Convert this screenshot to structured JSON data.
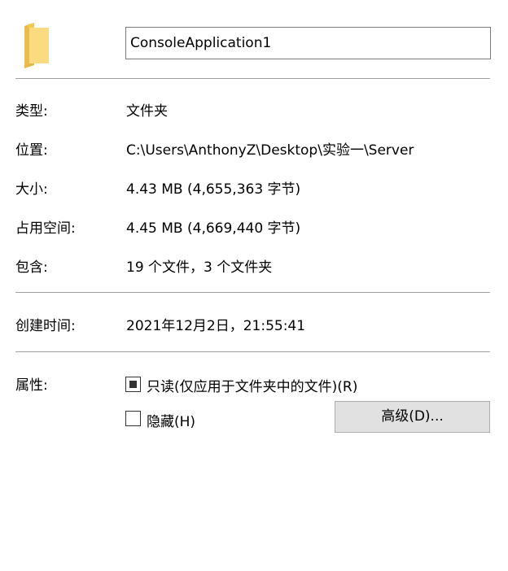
{
  "header": {
    "icon": "folder-icon",
    "name_value": "ConsoleApplication1"
  },
  "general": {
    "type_label": "类型:",
    "type_value": "文件夹",
    "location_label": "位置:",
    "location_value": "C:\\Users\\AnthonyZ\\Desktop\\实验一\\Server",
    "size_label": "大小:",
    "size_value": "4.43 MB (4,655,363 字节)",
    "size_on_disk_label": "占用空间:",
    "size_on_disk_value": "4.45 MB (4,669,440 字节)",
    "contains_label": "包含:",
    "contains_value": "19 个文件，3 个文件夹"
  },
  "dates": {
    "created_label": "创建时间:",
    "created_value": "2021年12月2日，21:55:41"
  },
  "attributes": {
    "label": "属性:",
    "readonly_label": "只读(仅应用于文件夹中的文件)(R)",
    "readonly_state": "indeterminate",
    "hidden_label": "隐藏(H)",
    "hidden_state": "unchecked",
    "advanced_button_label": "高级(D)..."
  },
  "colors": {
    "divider": "#a0a0a0",
    "button_bg": "#e1e1e1",
    "folder_yellow": "#f8d775",
    "folder_dark": "#e0b54a"
  }
}
